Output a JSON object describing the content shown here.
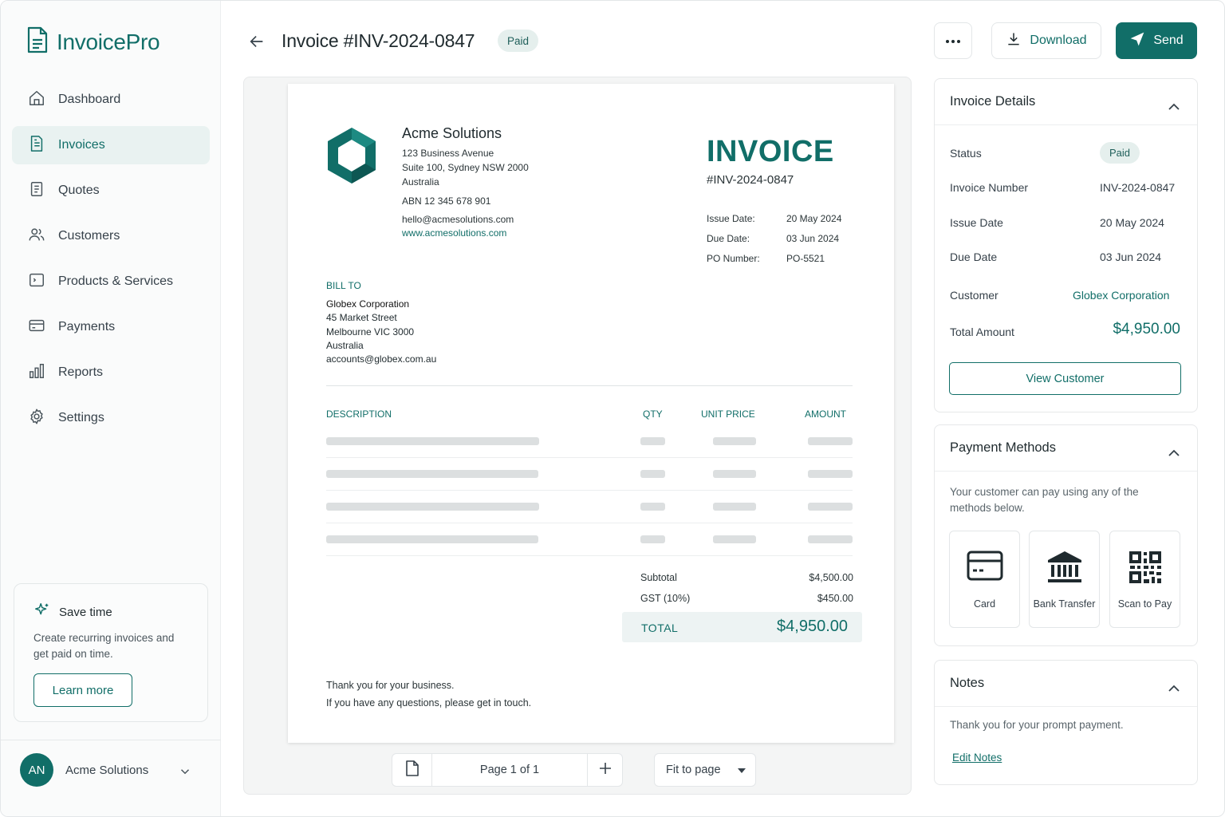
{
  "app": {
    "name": "InvoicePro"
  },
  "sidebar": {
    "items": [
      {
        "label": "Dashboard",
        "icon": "home-icon",
        "active": false
      },
      {
        "label": "Invoices",
        "icon": "invoice-icon",
        "active": true
      },
      {
        "label": "Quotes",
        "icon": "quote-icon",
        "active": false
      },
      {
        "label": "Customers",
        "icon": "users-icon",
        "active": false
      },
      {
        "label": "Products & Services",
        "icon": "tag-icon",
        "active": false
      },
      {
        "label": "Payments",
        "icon": "credit-card-icon",
        "active": false
      },
      {
        "label": "Reports",
        "icon": "bar-chart-icon",
        "active": false
      },
      {
        "label": "Settings",
        "icon": "gear-icon",
        "active": false
      }
    ],
    "promo": {
      "title": "Save time",
      "text": "Create recurring invoices and get paid on time.",
      "button": "Learn more"
    },
    "user": {
      "initials": "AN",
      "name": "Acme Solutions"
    }
  },
  "header": {
    "title": "Invoice #INV-2024-0847",
    "status": "Paid",
    "download_label": "Download",
    "send_label": "Send"
  },
  "invoice": {
    "company": {
      "name": "Acme Solutions",
      "address_line1": "123 Business Avenue",
      "address_line2": "Suite 100, Sydney NSW 2000",
      "country": "Australia",
      "abn": "ABN 12 345 678 901",
      "email": "hello@acmesolutions.com",
      "website": "www.acmesolutions.com"
    },
    "heading": "INVOICE",
    "number": "#INV-2024-0847",
    "meta": [
      {
        "label": "Issue Date:",
        "value": "20 May 2024"
      },
      {
        "label": "Due Date:",
        "value": "03 Jun 2024"
      },
      {
        "label": "PO Number:",
        "value": "PO-5521"
      }
    ],
    "bill_to": {
      "label": "BILL TO",
      "name": "Globex Corporation",
      "street": "45 Market Street",
      "city": "Melbourne VIC 3000",
      "country": "Australia",
      "email": "accounts@globex.com.au"
    },
    "columns": {
      "description": "DESCRIPTION",
      "qty": "QTY",
      "unit_price": "UNIT PRICE",
      "amount": "AMOUNT"
    },
    "line_item_count": 4,
    "subtotal_label": "Subtotal",
    "subtotal": "$4,500.00",
    "tax_label": "GST (10%)",
    "tax": "$450.00",
    "total_label": "TOTAL",
    "total": "$4,950.00",
    "footer_line1": "Thank you for your business.",
    "footer_line2": "If you have any questions, please get in touch."
  },
  "viewer": {
    "page_label": "Page 1 of 1",
    "zoom_label": "Fit to page"
  },
  "details": {
    "title": "Invoice Details",
    "rows": [
      {
        "label": "Status",
        "value": "Paid"
      },
      {
        "label": "Invoice Number",
        "value": "INV-2024-0847"
      },
      {
        "label": "Issue Date",
        "value": "20 May 2024"
      },
      {
        "label": "Due Date",
        "value": "03 Jun 2024"
      },
      {
        "label": "Customer",
        "value": "Globex Corporation"
      },
      {
        "label": "Total Amount",
        "value": "$4,950.00"
      }
    ],
    "view_customer": "View Customer"
  },
  "payment_methods": {
    "title": "Payment Methods",
    "text": "Your customer can pay using any of the methods below.",
    "methods": [
      {
        "label": "Card",
        "icon": "card-icon"
      },
      {
        "label": "Bank Transfer",
        "icon": "bank-icon"
      },
      {
        "label": "Scan to Pay",
        "icon": "qr-code-icon"
      }
    ]
  },
  "notes": {
    "title": "Notes",
    "text": "Thank you for your prompt payment.",
    "edit_label": "Edit Notes"
  },
  "colors": {
    "brand": "#116e68",
    "badge_bg": "#e5efed",
    "active_nav_bg": "#e9f2f1"
  }
}
